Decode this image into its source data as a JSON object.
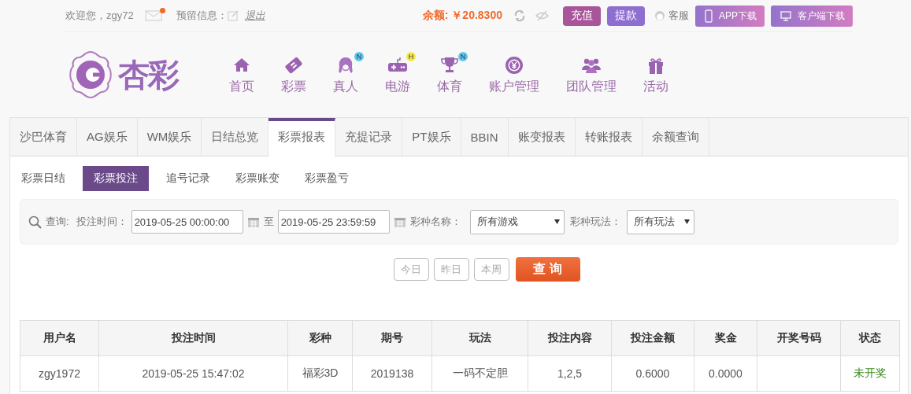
{
  "top_bar": {
    "welcome": "欢迎您，zgy72",
    "mail_unread": true,
    "note_label": "预留信息：",
    "logout": "退出",
    "balance_label": "余额:",
    "balance": "￥20.8300",
    "buttons": [
      {
        "label": "充值",
        "kind": "deposit"
      },
      {
        "label": "提款",
        "kind": "withdraw"
      }
    ],
    "service": "客服",
    "downloads": [
      {
        "label": "APP下载",
        "kind": "phone"
      },
      {
        "label": "客户端下载",
        "kind": "desktop"
      }
    ]
  },
  "logo": {
    "text": "杏彩"
  },
  "nav": [
    {
      "label": "首页",
      "kind": "home"
    },
    {
      "label": "彩票",
      "kind": "ticket"
    },
    {
      "label": "真人",
      "kind": "person",
      "badge": "N",
      "color": "#5bc8f0"
    },
    {
      "label": "电游",
      "kind": "gamepad",
      "badge": "H",
      "color": "#f5e94a"
    },
    {
      "label": "体育",
      "kind": "trophy",
      "badge": "N",
      "color": "#5bc8f0"
    },
    {
      "label": "账户管理",
      "kind": "coin"
    },
    {
      "label": "团队管理",
      "kind": "people"
    },
    {
      "label": "活动",
      "kind": "gift"
    }
  ],
  "tabs": [
    {
      "label": "沙巴体育",
      "selected": false
    },
    {
      "label": "AG娱乐",
      "selected": false
    },
    {
      "label": "WM娱乐",
      "selected": false
    },
    {
      "label": "日结总览",
      "selected": false
    },
    {
      "label": "彩票报表",
      "selected": true
    },
    {
      "label": "充提记录",
      "selected": false
    },
    {
      "label": "PT娱乐",
      "selected": false
    },
    {
      "label": "BBIN",
      "selected": false
    },
    {
      "label": "账变报表",
      "selected": false
    },
    {
      "label": "转账报表",
      "selected": false
    },
    {
      "label": "余额查询",
      "selected": false
    }
  ],
  "sub_tabs": [
    {
      "label": "彩票日结",
      "selected": false
    },
    {
      "label": "彩票投注",
      "selected": true
    },
    {
      "label": "追号记录",
      "selected": false
    },
    {
      "label": "彩票账变",
      "selected": false
    },
    {
      "label": "彩票盈亏",
      "selected": false
    }
  ],
  "filter": {
    "search_label": "查询:",
    "time_label": "投注时间：",
    "start": "2019-05-25 00:00:00",
    "to": "至",
    "end": "2019-05-25 23:59:59",
    "game_label": "彩种名称：",
    "game_value": "所有游戏",
    "play_label": "彩种玩法：",
    "play_value": "所有玩法"
  },
  "quick_buttons": [
    "今日",
    "昨日",
    "本周"
  ],
  "query_button": "查 询",
  "table": {
    "columns": [
      "用户名",
      "投注时间",
      "彩种",
      "期号",
      "玩法",
      "投注内容",
      "投注金额",
      "奖金",
      "开奖号码",
      "状态"
    ],
    "rows": [
      {
        "cells": [
          "zgy1972",
          "2019-05-25 15:47:02",
          "福彩3D",
          "2019138",
          "一码不定胆",
          "1,2,5",
          "0.6000",
          "0.0000",
          "",
          "未开奖"
        ],
        "color": "#3a8a1e"
      }
    ]
  }
}
